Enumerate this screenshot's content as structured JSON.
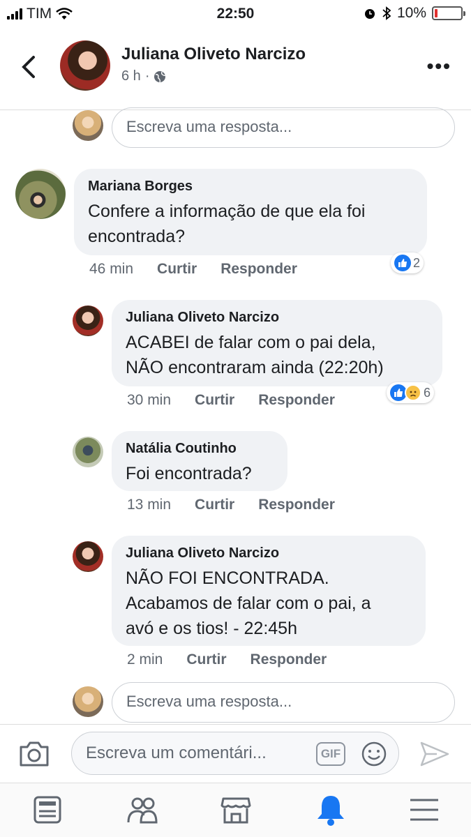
{
  "status_bar": {
    "carrier": "TIM",
    "time": "22:50",
    "battery": "10%",
    "battery_level": 0.1
  },
  "header": {
    "name": "Juliana Oliveto Narcizo",
    "time": "6 h",
    "separator": "·"
  },
  "reply_placeholder": "Escreva uma resposta...",
  "comments": [
    {
      "author": "Mariana Borges",
      "lines": [
        "Confere a informação de que ela foi",
        "encontrada?"
      ],
      "time": "46 min",
      "like": "Curtir",
      "reply": "Responder",
      "reaction_count": "2"
    },
    {
      "author": "Juliana Oliveto Narcizo",
      "lines": [
        "ACABEI de falar com o pai dela,",
        "NÃO encontraram ainda (22:20h)"
      ],
      "time": "30 min",
      "like": "Curtir",
      "reply": "Responder",
      "reaction_count": "6"
    },
    {
      "author": "Natália Coutinho",
      "lines": [
        "Foi encontrada?"
      ],
      "time": "13 min",
      "like": "Curtir",
      "reply": "Responder"
    },
    {
      "author": "Juliana Oliveto Narcizo",
      "lines": [
        "NÃO FOI ENCONTRADA.",
        "Acabamos de falar com o pai, a",
        "avó e os tios! - 22:45h"
      ],
      "time": "2 min",
      "like": "Curtir",
      "reply": "Responder"
    }
  ],
  "composer": {
    "placeholder": "Escreva um comentári...",
    "gif": "GIF"
  },
  "tabs": [
    "news-feed-icon",
    "friends-icon",
    "marketplace-icon",
    "notifications-icon",
    "menu-icon"
  ],
  "colors": {
    "accent": "#1877f2",
    "bubble": "#f0f2f5",
    "battery_low": "#e0312f"
  }
}
